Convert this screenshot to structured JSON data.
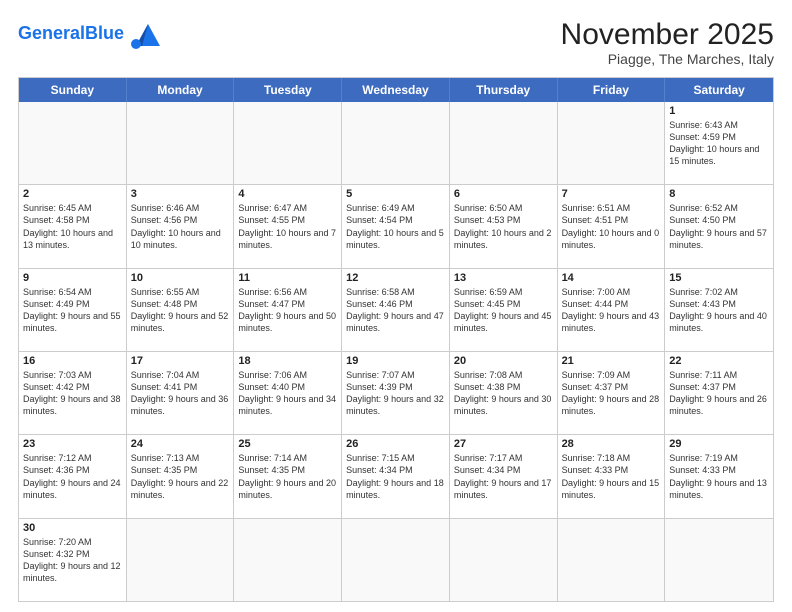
{
  "header": {
    "logo_general": "General",
    "logo_blue": "Blue",
    "title": "November 2025",
    "subtitle": "Piagge, The Marches, Italy"
  },
  "days_of_week": [
    "Sunday",
    "Monday",
    "Tuesday",
    "Wednesday",
    "Thursday",
    "Friday",
    "Saturday"
  ],
  "weeks": [
    [
      {
        "day": "",
        "info": ""
      },
      {
        "day": "",
        "info": ""
      },
      {
        "day": "",
        "info": ""
      },
      {
        "day": "",
        "info": ""
      },
      {
        "day": "",
        "info": ""
      },
      {
        "day": "",
        "info": ""
      },
      {
        "day": "1",
        "info": "Sunrise: 6:43 AM\nSunset: 4:59 PM\nDaylight: 10 hours and 15 minutes."
      }
    ],
    [
      {
        "day": "2",
        "info": "Sunrise: 6:45 AM\nSunset: 4:58 PM\nDaylight: 10 hours and 13 minutes."
      },
      {
        "day": "3",
        "info": "Sunrise: 6:46 AM\nSunset: 4:56 PM\nDaylight: 10 hours and 10 minutes."
      },
      {
        "day": "4",
        "info": "Sunrise: 6:47 AM\nSunset: 4:55 PM\nDaylight: 10 hours and 7 minutes."
      },
      {
        "day": "5",
        "info": "Sunrise: 6:49 AM\nSunset: 4:54 PM\nDaylight: 10 hours and 5 minutes."
      },
      {
        "day": "6",
        "info": "Sunrise: 6:50 AM\nSunset: 4:53 PM\nDaylight: 10 hours and 2 minutes."
      },
      {
        "day": "7",
        "info": "Sunrise: 6:51 AM\nSunset: 4:51 PM\nDaylight: 10 hours and 0 minutes."
      },
      {
        "day": "8",
        "info": "Sunrise: 6:52 AM\nSunset: 4:50 PM\nDaylight: 9 hours and 57 minutes."
      }
    ],
    [
      {
        "day": "9",
        "info": "Sunrise: 6:54 AM\nSunset: 4:49 PM\nDaylight: 9 hours and 55 minutes."
      },
      {
        "day": "10",
        "info": "Sunrise: 6:55 AM\nSunset: 4:48 PM\nDaylight: 9 hours and 52 minutes."
      },
      {
        "day": "11",
        "info": "Sunrise: 6:56 AM\nSunset: 4:47 PM\nDaylight: 9 hours and 50 minutes."
      },
      {
        "day": "12",
        "info": "Sunrise: 6:58 AM\nSunset: 4:46 PM\nDaylight: 9 hours and 47 minutes."
      },
      {
        "day": "13",
        "info": "Sunrise: 6:59 AM\nSunset: 4:45 PM\nDaylight: 9 hours and 45 minutes."
      },
      {
        "day": "14",
        "info": "Sunrise: 7:00 AM\nSunset: 4:44 PM\nDaylight: 9 hours and 43 minutes."
      },
      {
        "day": "15",
        "info": "Sunrise: 7:02 AM\nSunset: 4:43 PM\nDaylight: 9 hours and 40 minutes."
      }
    ],
    [
      {
        "day": "16",
        "info": "Sunrise: 7:03 AM\nSunset: 4:42 PM\nDaylight: 9 hours and 38 minutes."
      },
      {
        "day": "17",
        "info": "Sunrise: 7:04 AM\nSunset: 4:41 PM\nDaylight: 9 hours and 36 minutes."
      },
      {
        "day": "18",
        "info": "Sunrise: 7:06 AM\nSunset: 4:40 PM\nDaylight: 9 hours and 34 minutes."
      },
      {
        "day": "19",
        "info": "Sunrise: 7:07 AM\nSunset: 4:39 PM\nDaylight: 9 hours and 32 minutes."
      },
      {
        "day": "20",
        "info": "Sunrise: 7:08 AM\nSunset: 4:38 PM\nDaylight: 9 hours and 30 minutes."
      },
      {
        "day": "21",
        "info": "Sunrise: 7:09 AM\nSunset: 4:37 PM\nDaylight: 9 hours and 28 minutes."
      },
      {
        "day": "22",
        "info": "Sunrise: 7:11 AM\nSunset: 4:37 PM\nDaylight: 9 hours and 26 minutes."
      }
    ],
    [
      {
        "day": "23",
        "info": "Sunrise: 7:12 AM\nSunset: 4:36 PM\nDaylight: 9 hours and 24 minutes."
      },
      {
        "day": "24",
        "info": "Sunrise: 7:13 AM\nSunset: 4:35 PM\nDaylight: 9 hours and 22 minutes."
      },
      {
        "day": "25",
        "info": "Sunrise: 7:14 AM\nSunset: 4:35 PM\nDaylight: 9 hours and 20 minutes."
      },
      {
        "day": "26",
        "info": "Sunrise: 7:15 AM\nSunset: 4:34 PM\nDaylight: 9 hours and 18 minutes."
      },
      {
        "day": "27",
        "info": "Sunrise: 7:17 AM\nSunset: 4:34 PM\nDaylight: 9 hours and 17 minutes."
      },
      {
        "day": "28",
        "info": "Sunrise: 7:18 AM\nSunset: 4:33 PM\nDaylight: 9 hours and 15 minutes."
      },
      {
        "day": "29",
        "info": "Sunrise: 7:19 AM\nSunset: 4:33 PM\nDaylight: 9 hours and 13 minutes."
      }
    ],
    [
      {
        "day": "30",
        "info": "Sunrise: 7:20 AM\nSunset: 4:32 PM\nDaylight: 9 hours and 12 minutes."
      },
      {
        "day": "",
        "info": ""
      },
      {
        "day": "",
        "info": ""
      },
      {
        "day": "",
        "info": ""
      },
      {
        "day": "",
        "info": ""
      },
      {
        "day": "",
        "info": ""
      },
      {
        "day": "",
        "info": ""
      }
    ]
  ]
}
